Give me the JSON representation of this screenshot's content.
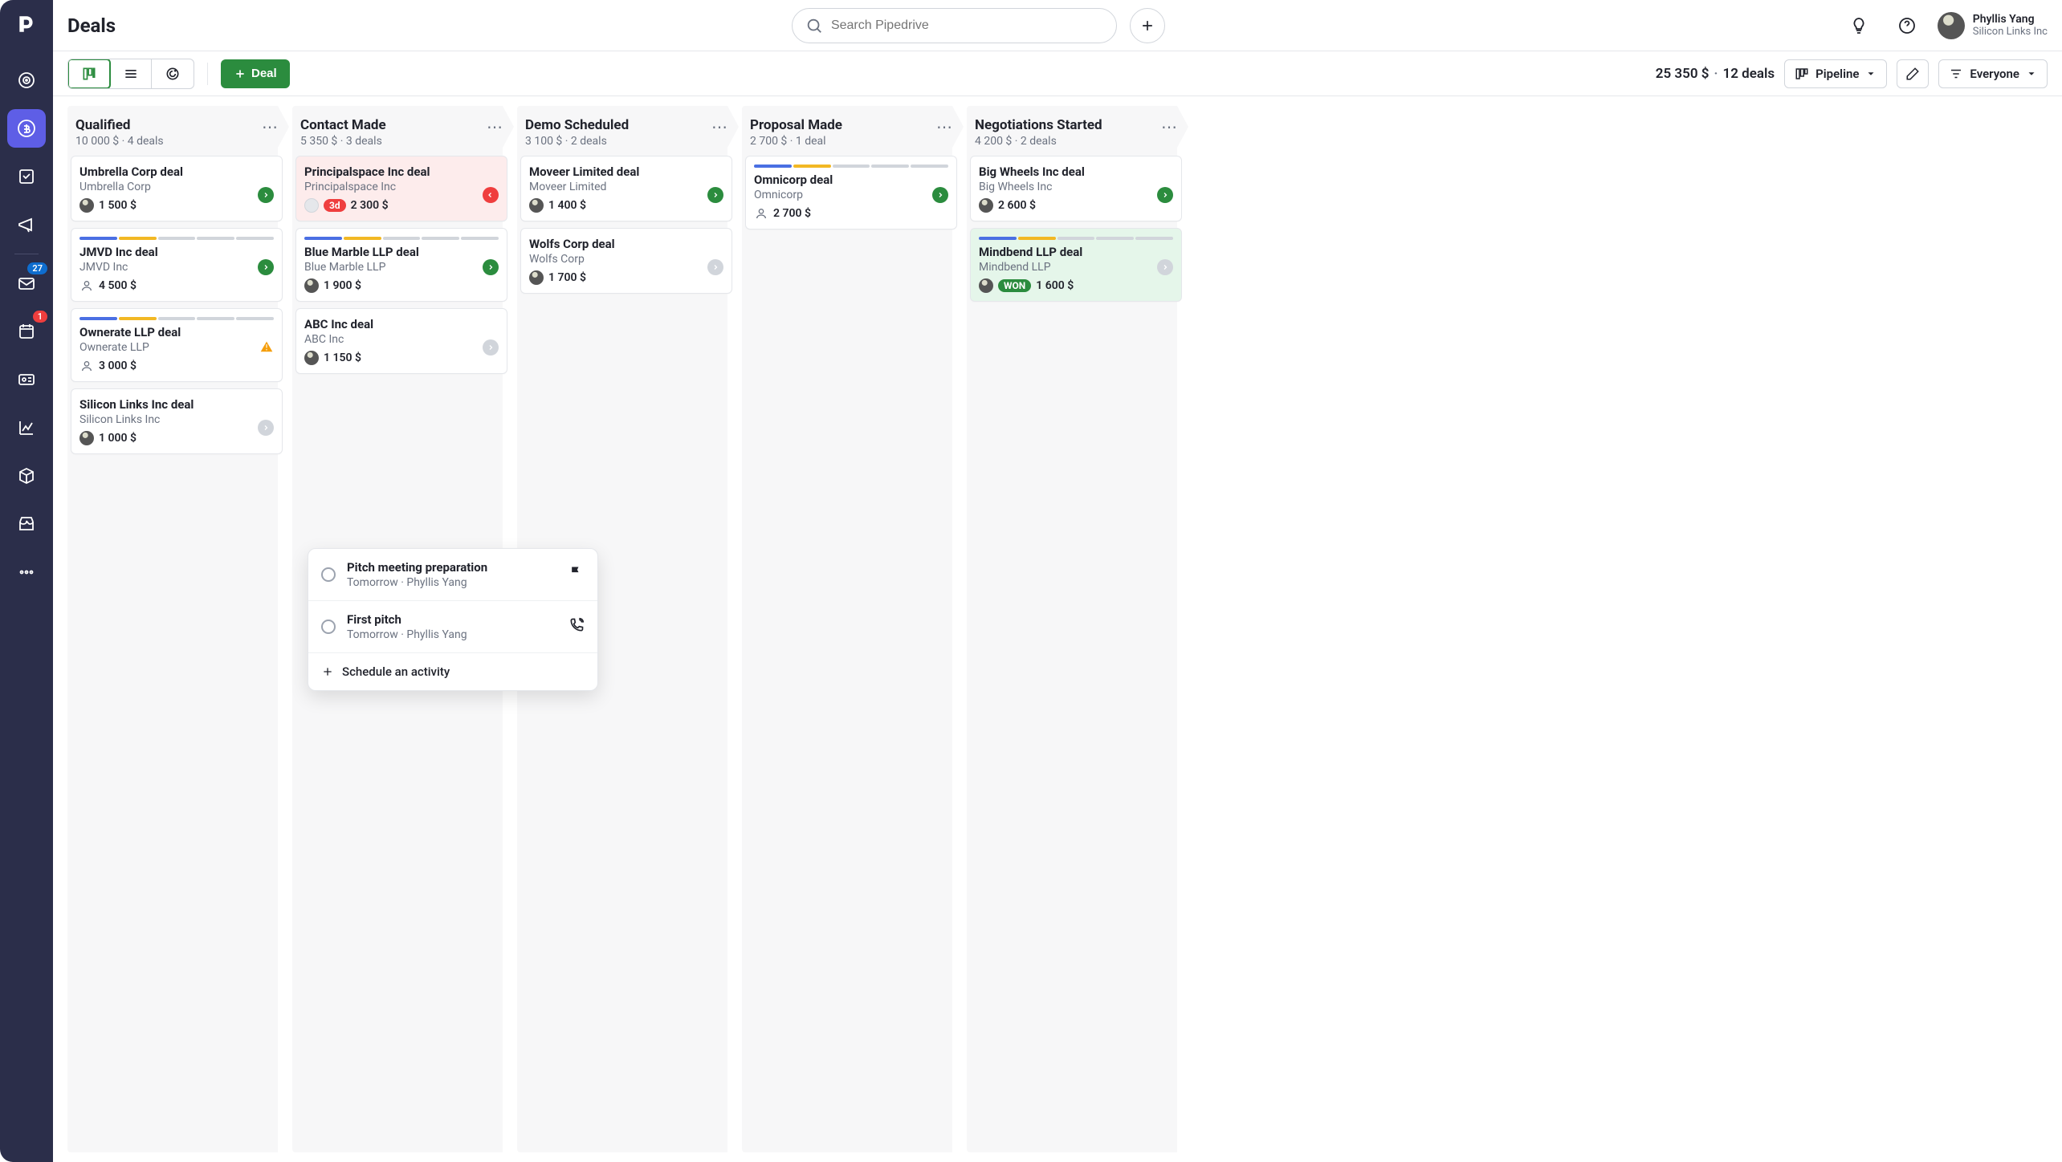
{
  "header": {
    "title": "Deals",
    "search_placeholder": "Search Pipedrive",
    "user": {
      "name": "Phyllis Yang",
      "org": "Silicon Links Inc"
    }
  },
  "sidebar": {
    "mail_badge": "27",
    "activity_badge": "1"
  },
  "toolbar": {
    "deal_button": "Deal",
    "summary_amount": "25 350 $",
    "summary_count": "12 deals",
    "pipeline_label": "Pipeline",
    "filter_label": "Everyone"
  },
  "columns": [
    {
      "title": "Qualified",
      "summary": "10 000 $ · 4 deals",
      "cards": [
        {
          "title": "Umbrella Corp deal",
          "org": "Umbrella Corp",
          "amount": "1 500 $",
          "status": "green",
          "avatar": "photo"
        },
        {
          "title": "JMVD Inc deal",
          "org": "JMVD Inc",
          "amount": "4 500 $",
          "status": "green",
          "progress": true,
          "avatar": "person"
        },
        {
          "title": "Ownerate LLP deal",
          "org": "Ownerate LLP",
          "amount": "3 000 $",
          "status": "warn",
          "progress": true,
          "avatar": "person"
        },
        {
          "title": "Silicon Links Inc deal",
          "org": "Silicon Links Inc",
          "amount": "1 000 $",
          "status": "grey",
          "avatar": "photo"
        }
      ]
    },
    {
      "title": "Contact Made",
      "summary": "5 350 $ · 3 deals",
      "cards": [
        {
          "title": "Principalspace Inc deal",
          "org": "Principalspace Inc",
          "amount": "2 300 $",
          "status": "red",
          "overdue": true,
          "chip": "3d",
          "avatar": "empty"
        },
        {
          "title": "Blue Marble LLP deal",
          "org": "Blue Marble LLP",
          "amount": "1 900 $",
          "status": "green",
          "progress": true,
          "avatar": "photo"
        },
        {
          "title": "ABC Inc deal",
          "org": "ABC Inc",
          "amount": "1 150 $",
          "status": "grey",
          "avatar": "photo",
          "popup": true
        }
      ]
    },
    {
      "title": "Demo Scheduled",
      "summary": "3 100 $ · 2 deals",
      "cards": [
        {
          "title": "Moveer Limited deal",
          "org": "Moveer Limited",
          "amount": "1 400 $",
          "status": "green",
          "avatar": "photo"
        },
        {
          "title": "Wolfs Corp deal",
          "org": "Wolfs Corp",
          "amount": "1 700 $",
          "status": "grey",
          "avatar": "photo"
        }
      ]
    },
    {
      "title": "Proposal Made",
      "summary": "2 700 $ · 1 deal",
      "cards": [
        {
          "title": "Omnicorp deal",
          "org": "Omnicorp",
          "amount": "2 700 $",
          "status": "green",
          "progress": true,
          "avatar": "person"
        }
      ]
    },
    {
      "title": "Negotiations Started",
      "summary": "4 200 $ · 2 deals",
      "cards": [
        {
          "title": "Big Wheels Inc deal",
          "org": "Big Wheels Inc",
          "amount": "2 600 $",
          "status": "green",
          "avatar": "photo"
        },
        {
          "title": "Mindbend LLP deal",
          "org": "Mindbend LLP",
          "amount": "1 600 $",
          "status": "grey",
          "won": true,
          "won_label": "WON",
          "progress": true,
          "avatar": "photo"
        }
      ]
    }
  ],
  "popup": {
    "activities": [
      {
        "title": "Pitch meeting preparation",
        "sub": "Tomorrow · Phyllis Yang",
        "icon": "flag"
      },
      {
        "title": "First pitch",
        "sub": "Tomorrow · Phyllis Yang",
        "icon": "call"
      }
    ],
    "schedule_label": "Schedule an activity"
  }
}
